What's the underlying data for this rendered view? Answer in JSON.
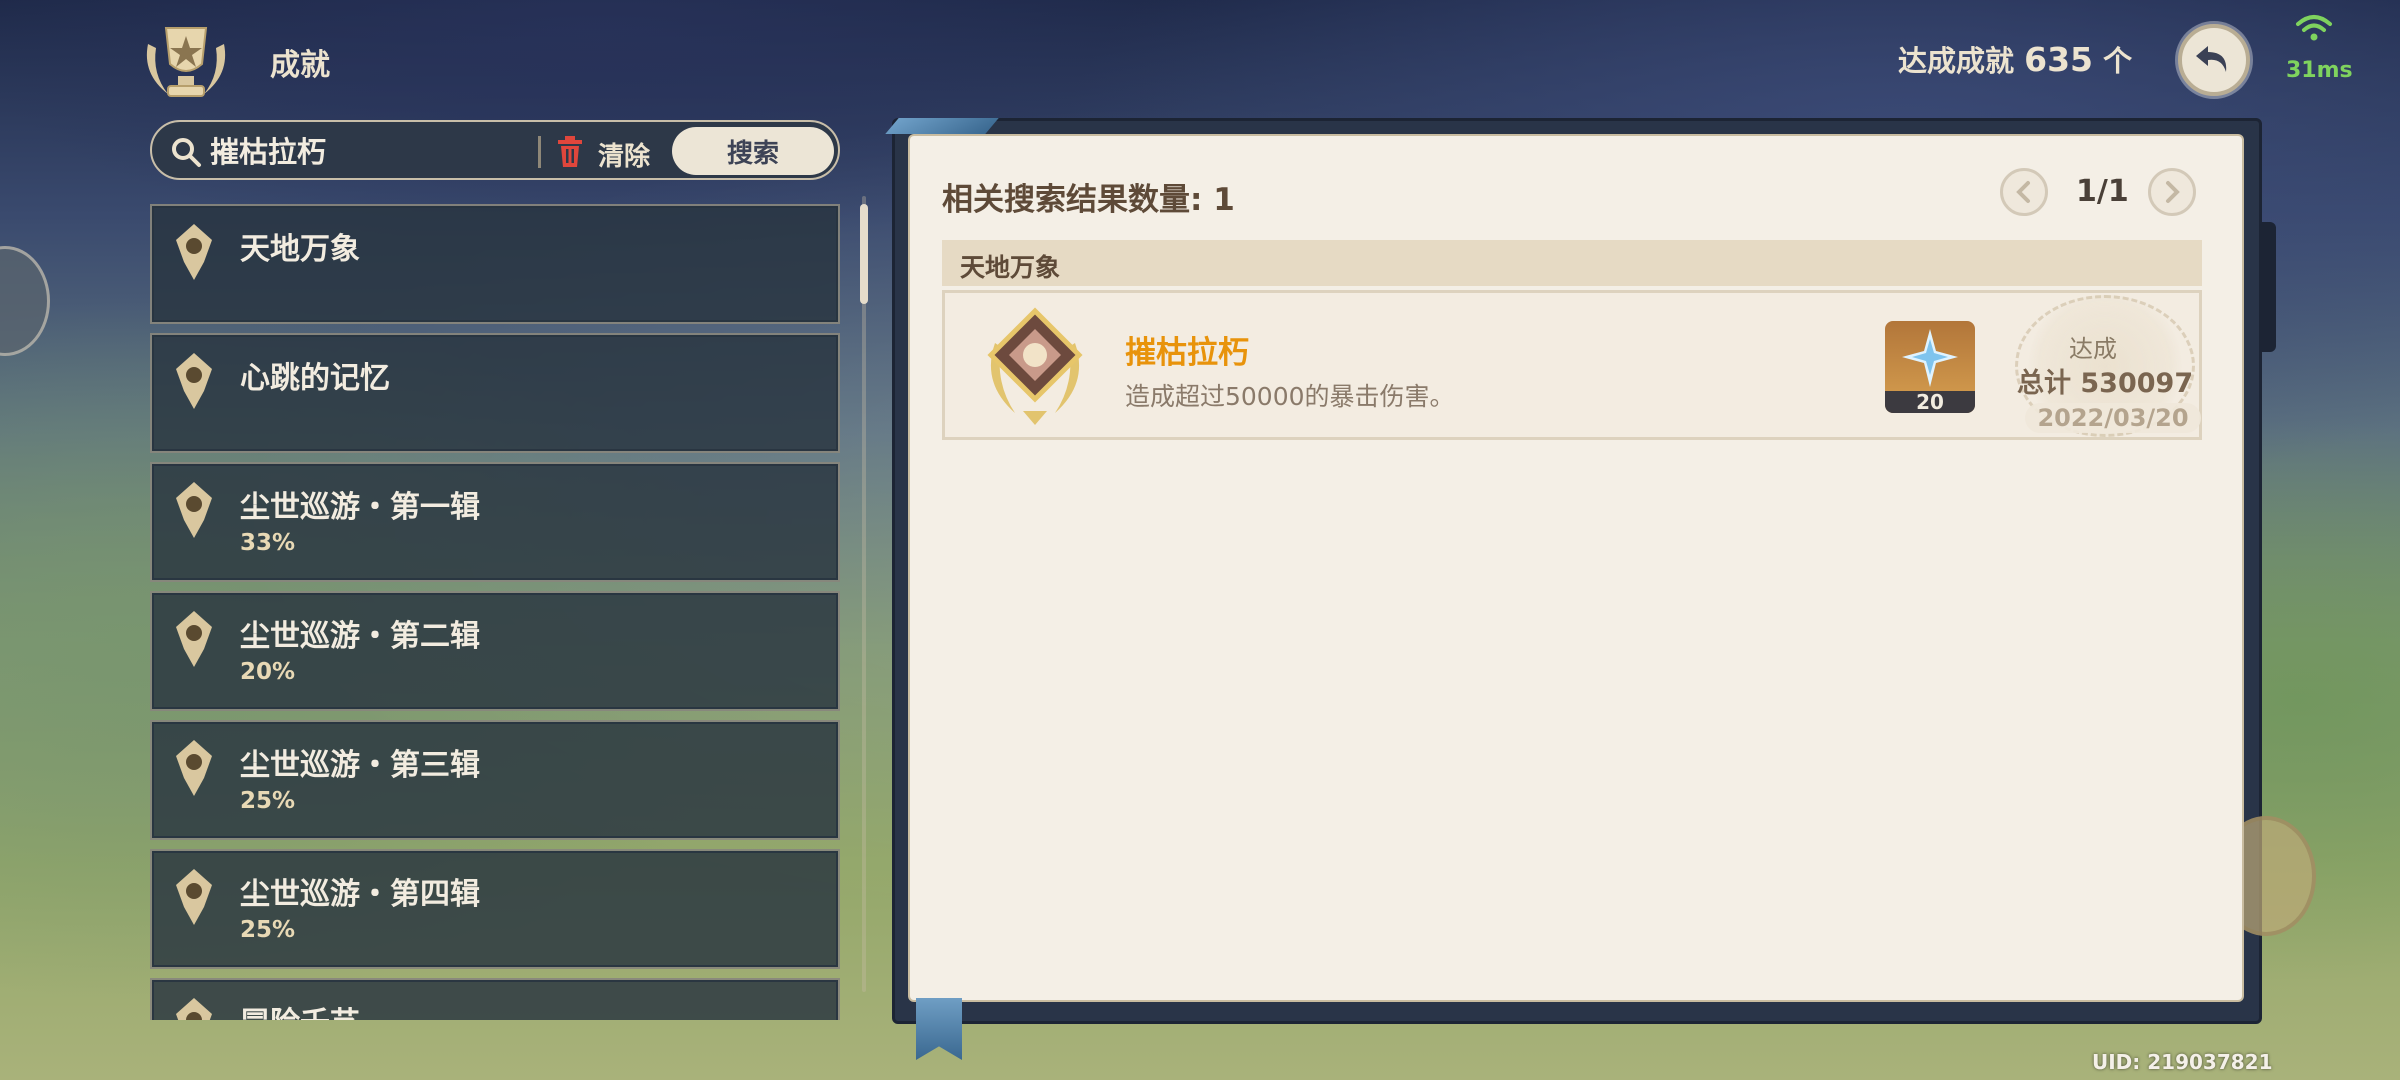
{
  "header": {
    "title": "成就",
    "achieved_label": "达成成就",
    "achieved_count": "635",
    "achieved_unit": "个",
    "ping": "31ms"
  },
  "search": {
    "value": "摧枯拉朽",
    "clear_label": "清除",
    "button_label": "搜索"
  },
  "categories": [
    {
      "name": "天地万象",
      "percent": ""
    },
    {
      "name": "心跳的记忆",
      "percent": ""
    },
    {
      "name": "尘世巡游・第一辑",
      "percent": "33%"
    },
    {
      "name": "尘世巡游・第二辑",
      "percent": "20%"
    },
    {
      "name": "尘世巡游・第三辑",
      "percent": "25%"
    },
    {
      "name": "尘世巡游・第四辑",
      "percent": "25%"
    },
    {
      "name": "冒险千艺",
      "percent": ""
    }
  ],
  "results": {
    "count_label": "相关搜索结果数量: 1",
    "page": "1/1",
    "group": "天地万象",
    "item": {
      "name": "摧枯拉朽",
      "description": "造成超过50000的暴击伤害。",
      "reward_qty": "20",
      "stamp_label": "达成",
      "stamp_total": "总计 530097",
      "date": "2022/03/20"
    }
  },
  "footer": {
    "uid": "UID: 219037821"
  },
  "colors": {
    "accent_orange": "#e8930b",
    "panel_paper": "#f4efe6",
    "list_item_bg": "#283440",
    "ping_green": "#7fd35e"
  },
  "icons": [
    "trophy-icon",
    "back-arrow-icon",
    "wifi-icon",
    "search-icon",
    "trash-icon",
    "category-icon",
    "chevron-left-icon",
    "chevron-right-icon",
    "achievement-badge-icon",
    "primogem-icon"
  ]
}
